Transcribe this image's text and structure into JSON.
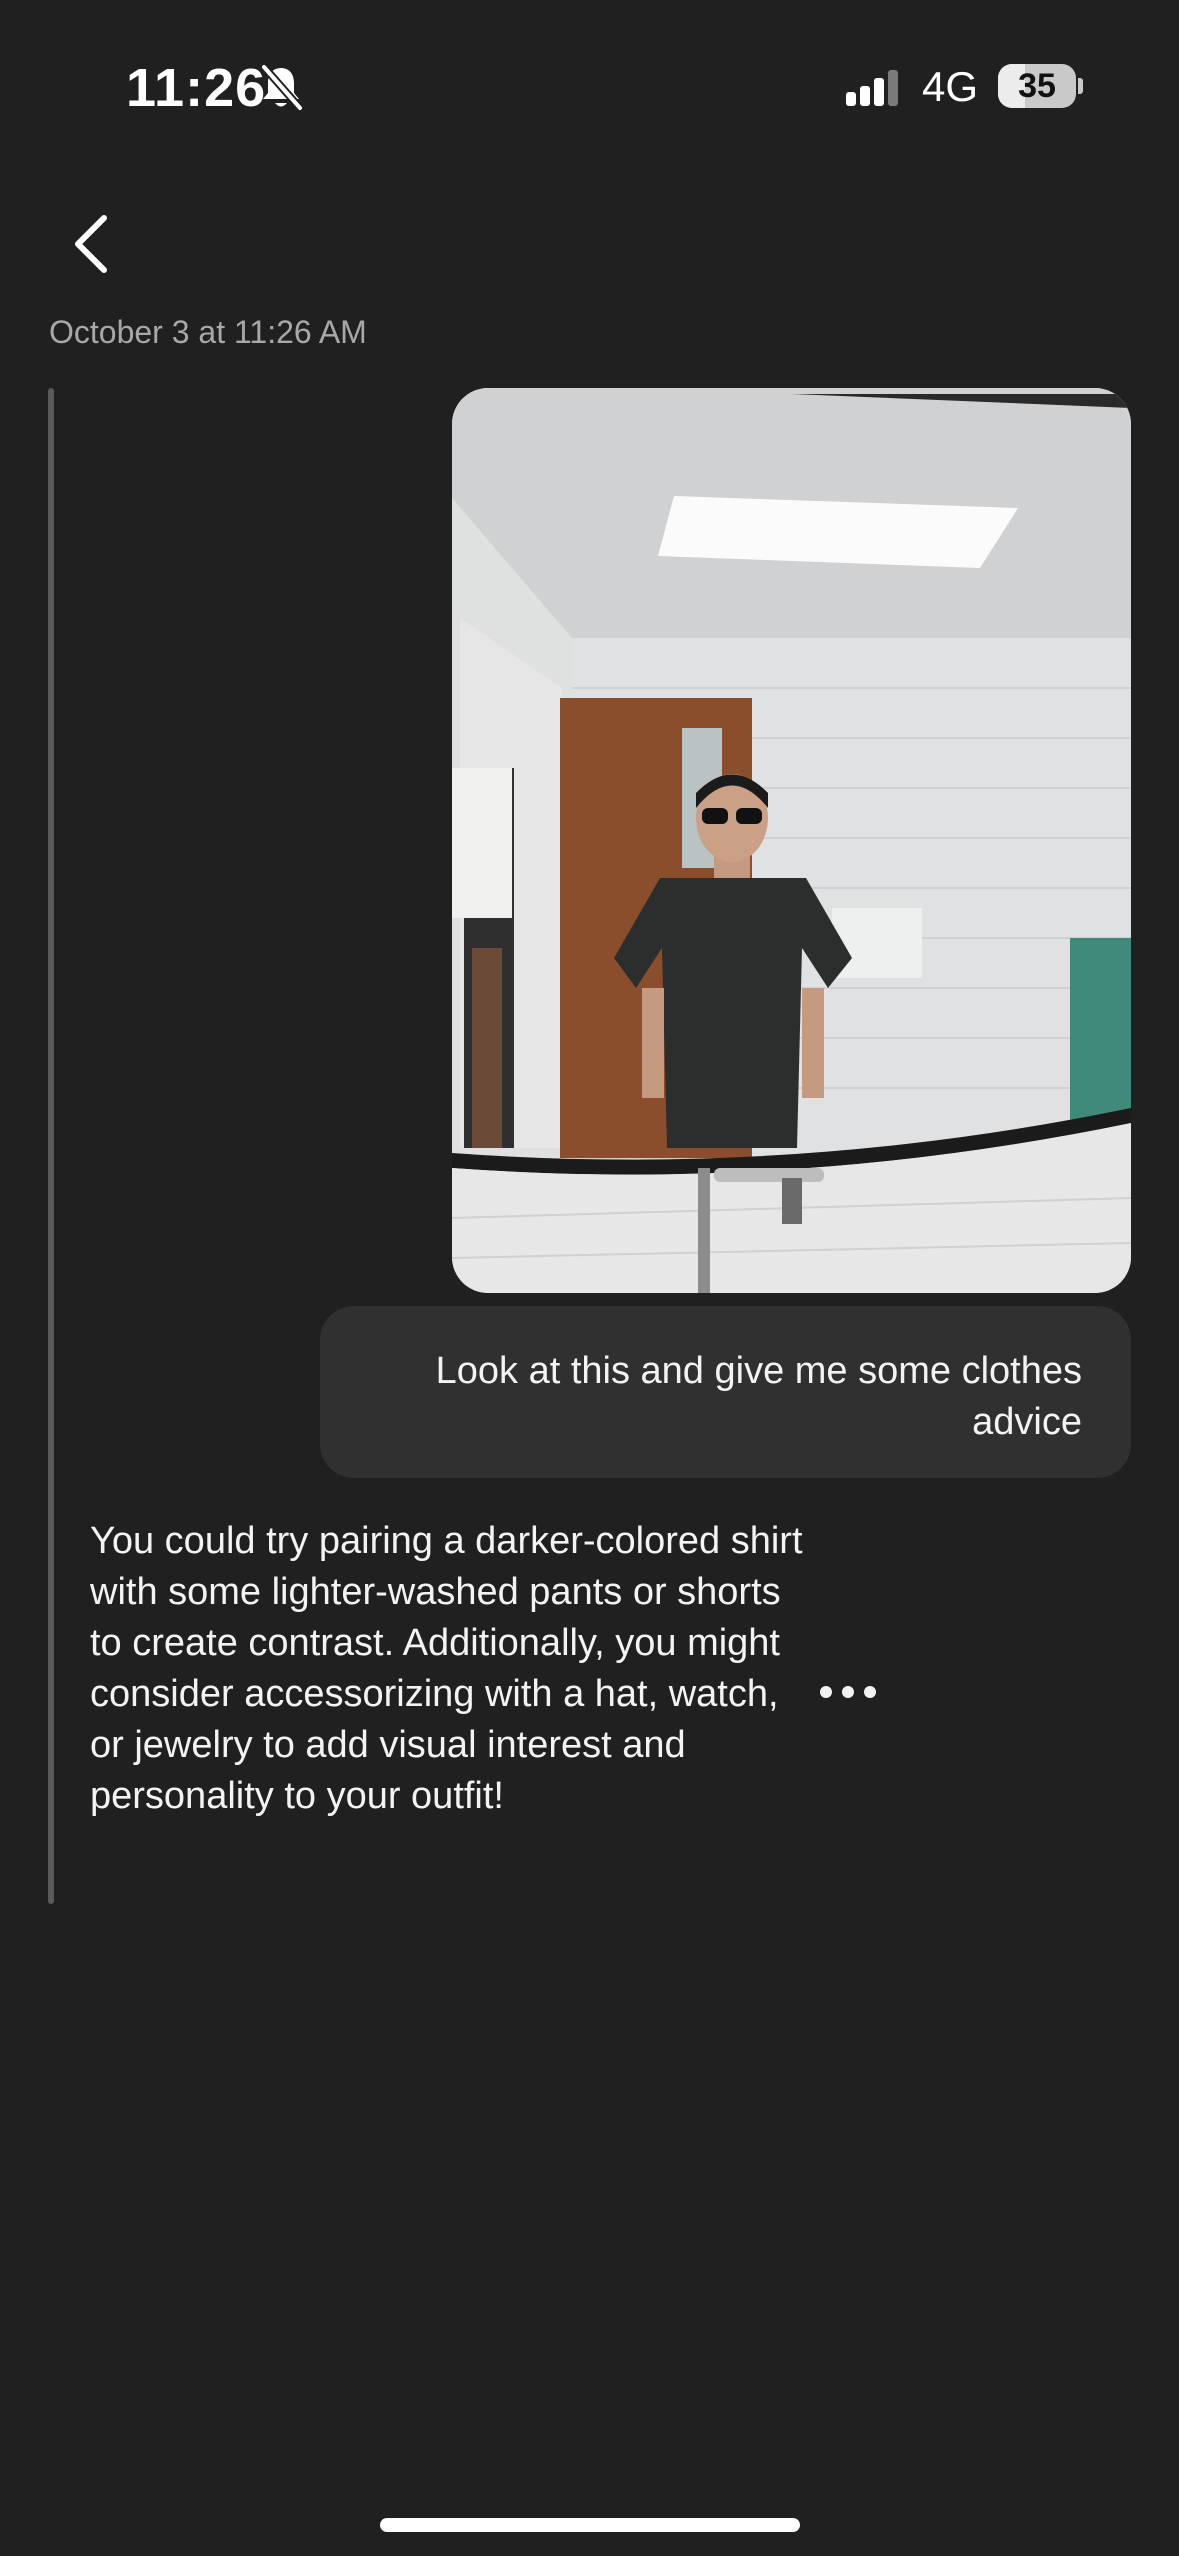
{
  "status_bar": {
    "time": "11:26",
    "network": "4G",
    "battery": "35",
    "battery_level": 0.35,
    "icons": [
      "bell-off-icon",
      "signal-icon",
      "battery-icon"
    ]
  },
  "header": {
    "back_icon": "chevron-left-icon",
    "timestamp": "October 3 at 11:26 AM"
  },
  "conversation": {
    "photo_icon": "mirror-selfie-photo",
    "user_message": "Look at this and give me some clothes advice",
    "ai_message": "You could try pairing a darker-colored shirt with some lighter-washed pants or shorts to create contrast. Additionally, you might consider accessorizing with a hat, watch, or jewelry to add visual interest and personality to your outfit!",
    "more_icon": "more-horizontal-icon"
  },
  "colors": {
    "background": "#202021",
    "bubble": "#303031",
    "timestamp": "#a8a8ab",
    "thread_line": "#5a5a5c"
  }
}
